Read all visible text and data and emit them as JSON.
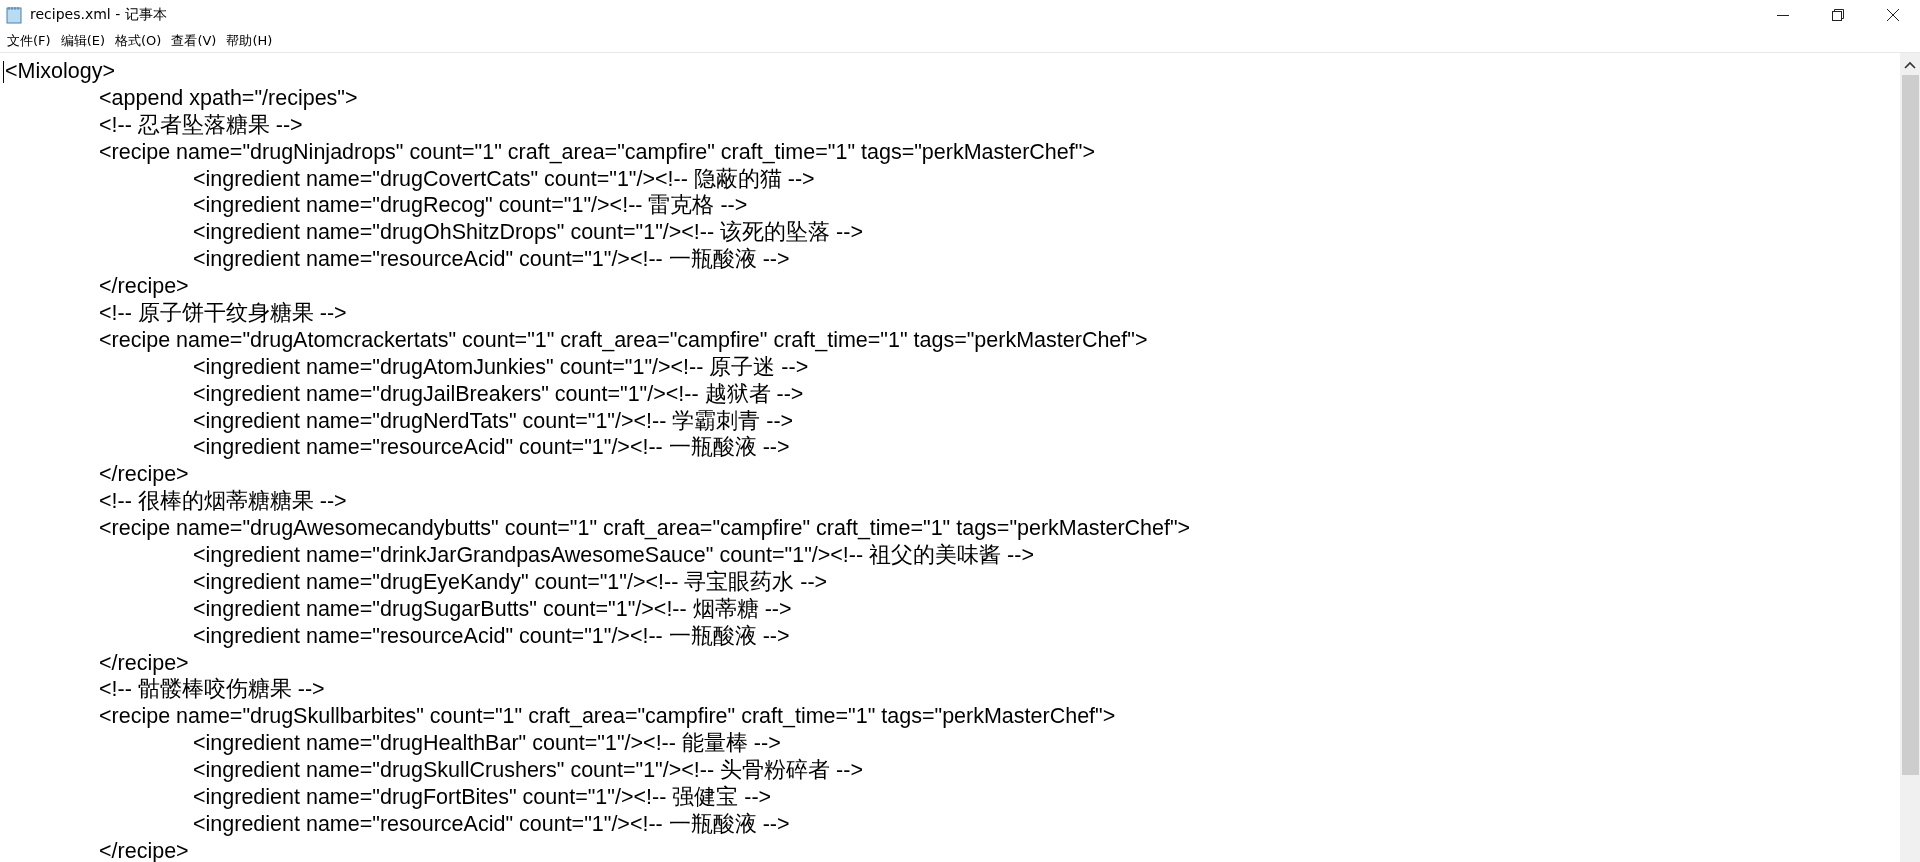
{
  "window": {
    "title": "recipes.xml - 记事本"
  },
  "menu": [
    "文件(F)",
    "编辑(E)",
    "格式(O)",
    "查看(V)",
    "帮助(H)"
  ],
  "lines": [
    {
      "text": "<Mixology>",
      "children": [
        {
          "text": "<append xpath=\"/recipes\">"
        },
        {
          "text": "<!-- 忍者坠落糖果 -->"
        },
        {
          "text": "<recipe name=\"drugNinjadrops\" count=\"1\" craft_area=\"campfire\" craft_time=\"1\" tags=\"perkMasterChef\">",
          "children": [
            {
              "text": "<ingredient name=\"drugCovertCats\" count=\"1\"/><!-- 隐蔽的猫 -->"
            },
            {
              "text": "<ingredient name=\"drugRecog\" count=\"1\"/><!-- 雷克格 -->"
            },
            {
              "text": "<ingredient name=\"drugOhShitzDrops\" count=\"1\"/><!-- 该死的坠落 -->"
            },
            {
              "text": "<ingredient name=\"resourceAcid\" count=\"1\"/><!-- 一瓶酸液 -->"
            }
          ]
        },
        {
          "text": "</recipe>"
        },
        {
          "text": "<!-- 原子饼干纹身糖果 -->"
        },
        {
          "text": "<recipe name=\"drugAtomcrackertats\" count=\"1\" craft_area=\"campfire\" craft_time=\"1\" tags=\"perkMasterChef\">",
          "children": [
            {
              "text": "<ingredient name=\"drugAtomJunkies\" count=\"1\"/><!-- 原子迷 -->"
            },
            {
              "text": "<ingredient name=\"drugJailBreakers\" count=\"1\"/><!-- 越狱者 -->"
            },
            {
              "text": "<ingredient name=\"drugNerdTats\" count=\"1\"/><!-- 学霸刺青 -->"
            },
            {
              "text": "<ingredient name=\"resourceAcid\" count=\"1\"/><!-- 一瓶酸液 -->"
            }
          ]
        },
        {
          "text": "</recipe>"
        },
        {
          "text": "<!-- 很棒的烟蒂糖糖果 -->"
        },
        {
          "text": "<recipe name=\"drugAwesomecandybutts\" count=\"1\" craft_area=\"campfire\" craft_time=\"1\" tags=\"perkMasterChef\">",
          "children": [
            {
              "text": "<ingredient name=\"drinkJarGrandpasAwesomeSauce\" count=\"1\"/><!-- 祖父的美味酱 -->"
            },
            {
              "text": "<ingredient name=\"drugEyeKandy\" count=\"1\"/><!-- 寻宝眼药水 -->"
            },
            {
              "text": "<ingredient name=\"drugSugarButts\" count=\"1\"/><!-- 烟蒂糖 -->"
            },
            {
              "text": "<ingredient name=\"resourceAcid\" count=\"1\"/><!-- 一瓶酸液 -->"
            }
          ]
        },
        {
          "text": "</recipe>"
        },
        {
          "text": "<!-- 骷髅棒咬伤糖果 -->"
        },
        {
          "text": "<recipe name=\"drugSkullbarbites\" count=\"1\" craft_area=\"campfire\" craft_time=\"1\" tags=\"perkMasterChef\">",
          "children": [
            {
              "text": "<ingredient name=\"drugHealthBar\" count=\"1\"/><!-- 能量棒 -->"
            },
            {
              "text": "<ingredient name=\"drugSkullCrushers\" count=\"1\"/><!-- 头骨粉碎者 -->"
            },
            {
              "text": "<ingredient name=\"drugFortBites\" count=\"1\"/><!-- 强健宝 -->"
            },
            {
              "text": "<ingredient name=\"resourceAcid\" count=\"1\"/><!-- 一瓶酸液 -->"
            }
          ]
        },
        {
          "text": "</recipe>"
        }
      ]
    }
  ]
}
